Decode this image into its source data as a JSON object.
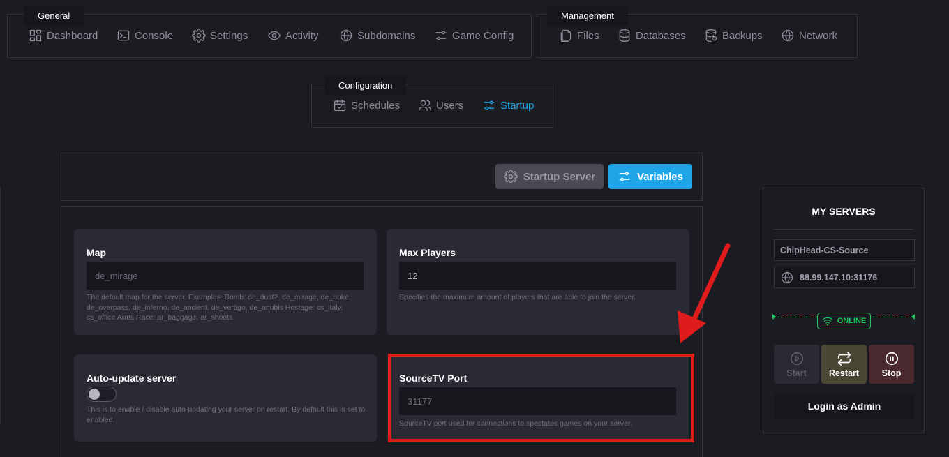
{
  "nav_general": {
    "title": "General",
    "items": [
      {
        "label": "Dashboard",
        "icon": "dashboard-icon"
      },
      {
        "label": "Console",
        "icon": "console-icon"
      },
      {
        "label": "Settings",
        "icon": "gear-icon"
      },
      {
        "label": "Activity",
        "icon": "eye-icon"
      },
      {
        "label": "Subdomains",
        "icon": "globe-icon"
      },
      {
        "label": "Game Config",
        "icon": "sliders-icon"
      }
    ]
  },
  "nav_management": {
    "title": "Management",
    "items": [
      {
        "label": "Files",
        "icon": "files-icon"
      },
      {
        "label": "Databases",
        "icon": "database-icon"
      },
      {
        "label": "Backups",
        "icon": "backup-icon"
      },
      {
        "label": "Network",
        "icon": "globe-icon"
      }
    ]
  },
  "nav_configuration": {
    "title": "Configuration",
    "items": [
      {
        "label": "Schedules",
        "icon": "calendar-check-icon"
      },
      {
        "label": "Users",
        "icon": "users-icon"
      },
      {
        "label": "Startup",
        "icon": "sliders-icon",
        "active": true
      }
    ]
  },
  "toolbar": {
    "startup_server_label": "Startup Server",
    "variables_label": "Variables"
  },
  "variables": {
    "map": {
      "label": "Map",
      "placeholder": "de_mirage",
      "help": "The default map for the server. Examples: Bomb: de_dust2, de_mirage, de_nuke, de_overpass, de_inferno, de_ancient, de_vertigo, de_anubis Hostage: cs_italy, cs_office Arms Race: ar_baggage, ar_shoots"
    },
    "max_players": {
      "label": "Max Players",
      "value": "12",
      "help": "Specifies the maximum amount of players that are able to join the server."
    },
    "auto_update": {
      "label": "Auto-update server",
      "enabled": false,
      "help": "This is to enable / disable auto-updating your server on restart. By default this is set to enabled."
    },
    "sourcetv_port": {
      "label": "SourceTV Port",
      "placeholder": "31177",
      "help": "SourceTV port used for connections to spectates games on your server."
    }
  },
  "my_servers": {
    "title": "MY SERVERS",
    "server_name": "ChipHead-CS-Source",
    "address": "88.99.147.10:31176",
    "status": "ONLINE",
    "start_label": "Start",
    "restart_label": "Restart",
    "stop_label": "Stop",
    "login_label": "Login as Admin"
  },
  "colors": {
    "accent": "#1ea5e8",
    "online": "#22c55e",
    "annotation": "#e01b1b",
    "background": "#1b1b22",
    "card": "#2a2a34"
  }
}
